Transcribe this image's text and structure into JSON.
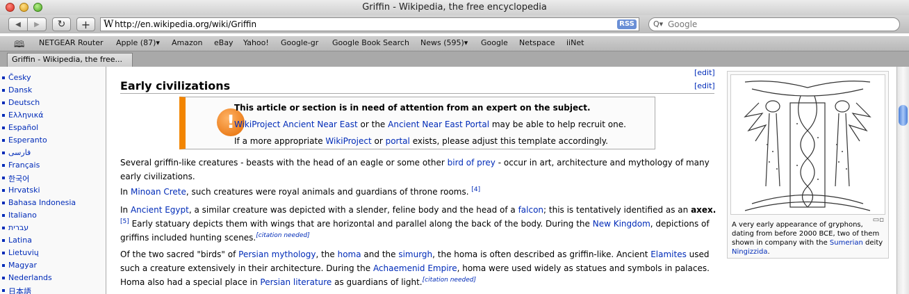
{
  "window": {
    "title": "Griffin - Wikipedia, the free encyclopedia"
  },
  "toolbar": {
    "back_label": "◀",
    "forward_label": "▶",
    "reload_label": "↻",
    "add_label": "+",
    "url_prefix": "W",
    "url": "http://en.wikipedia.org/wiki/Griffin",
    "rss_label": "RSS",
    "search_placeholder": "Google"
  },
  "bookmarks": [
    "NETGEAR Router",
    "Apple (87)▾",
    "Amazon",
    "eBay",
    "Yahoo!",
    "Google-gr",
    "Google Book Search",
    "News (595)▾",
    "Google",
    "Netspace",
    "iiNet"
  ],
  "tab": {
    "label": "Griffin - Wikipedia, the free..."
  },
  "sidebar": {
    "languages": [
      "Česky",
      "Dansk",
      "Deutsch",
      "Ελληνικά",
      "Español",
      "Esperanto",
      "فارسی",
      "Français",
      "한국어",
      "Hrvatski",
      "Bahasa Indonesia",
      "Italiano",
      "עברית",
      "Latina",
      "Lietuvių",
      "Magyar",
      "Nederlands",
      "日本語"
    ]
  },
  "article": {
    "edit_label": "[edit]",
    "heading": "Early civilizations",
    "ambox": {
      "line1": "This article or section is in need of attention from an expert on the subject.",
      "line2_link1": "WikiProject Ancient Near East",
      "line2_mid": " or the ",
      "line2_link2": "Ancient Near East Portal",
      "line2_end": " may be able to help recruit one.",
      "line3_start": "If a more appropriate ",
      "line3_link1": "WikiProject",
      "line3_mid": " or ",
      "line3_link2": "portal",
      "line3_end": " exists, please adjust this template accordingly.",
      "icon": "!"
    },
    "p1": {
      "start": "Several griffin-like creatures - beasts with the head of an eagle or some other ",
      "link": "bird of prey",
      "end": " - occur in art, architecture and mythology of many early civilizations."
    },
    "p2": {
      "start": "In ",
      "link": "Minoan Crete",
      "end": ", such creatures were royal animals and guardians of throne rooms. ",
      "ref": "[4]"
    },
    "p3": {
      "start": "In ",
      "link1": "Ancient Egypt",
      "mid1": ", a similar creature was depicted with a slender, feline body and the head of a ",
      "link2": "falcon",
      "mid2": "; this is tentatively identified as an ",
      "bold": "axex.",
      "ref": "[5]",
      "mid3": " Early statuary depicts them with wings that are horizontal and parallel along the back of the body. During the ",
      "link3": "New Kingdom",
      "end": ", depictions of griffins included hunting scenes.",
      "cn": "[citation needed]"
    },
    "p4": {
      "start": "Of the two sacred \"birds\" of ",
      "link1": "Persian mythology",
      "mid1": ", the ",
      "link2": "homa",
      "mid2": " and the ",
      "link3": "simurgh",
      "mid3": ", the homa is often described as griffin-like. Ancient ",
      "link4": "Elamites",
      "mid4": " used such a creature extensively in their architecture. During the ",
      "link5": "Achaemenid Empire",
      "mid5": ", homa were used widely as statues and symbols in palaces. Homa also had a special place in ",
      "link6": "Persian literature",
      "end": " as guardians of light.",
      "cn": "[citation needed]"
    }
  },
  "thumb": {
    "caption_start": "A very early appearance of gryphons, dating from before 2000 BCE, two of them shown in company with the ",
    "caption_link1": "Sumerian",
    "caption_mid": " deity ",
    "caption_link2": "Ningizzida",
    "caption_end": "."
  }
}
